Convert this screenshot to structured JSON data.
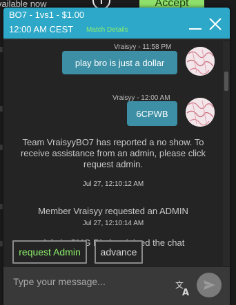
{
  "background": {
    "left_text": "vailable now",
    "accept_label": "Accept",
    "accept_color": "#8ee06b"
  },
  "header": {
    "title_line1": "BO7 - 1vs1 - $1.00",
    "title_line2": "12:00 AM CEST",
    "match_details": "Match Details",
    "color": "#2ea8c8"
  },
  "messages": [
    {
      "type": "outgoing",
      "sender_time": "Vraisyy - 11:58 PM",
      "text": "play bro is just a dollar"
    },
    {
      "type": "outgoing",
      "sender_time": "Vraisyy - 12:00 AM",
      "text": "6CPWB"
    },
    {
      "type": "system",
      "text": "Team VraisyyBO7 has reported a no show. To receive assistance from an admin, please click request admin.",
      "time": "Jul 27, 12:10:12 AM"
    },
    {
      "type": "system",
      "text": "Member Vraisyy requested an ADMIN",
      "time": "Jul 27, 12:10:14 AM"
    },
    {
      "type": "system",
      "text": "Admin CMG Rio has joined the chat"
    }
  ],
  "actions": {
    "request_admin": "request Admin",
    "request_admin_color": "#8ef06c",
    "advance": "advance"
  },
  "composer": {
    "placeholder": "Type your message...",
    "translate_icon": "translate-icon",
    "send_icon": "send-icon"
  },
  "colors": {
    "bubble": "#3c8fa5",
    "accent_green": "#8ef06c"
  }
}
